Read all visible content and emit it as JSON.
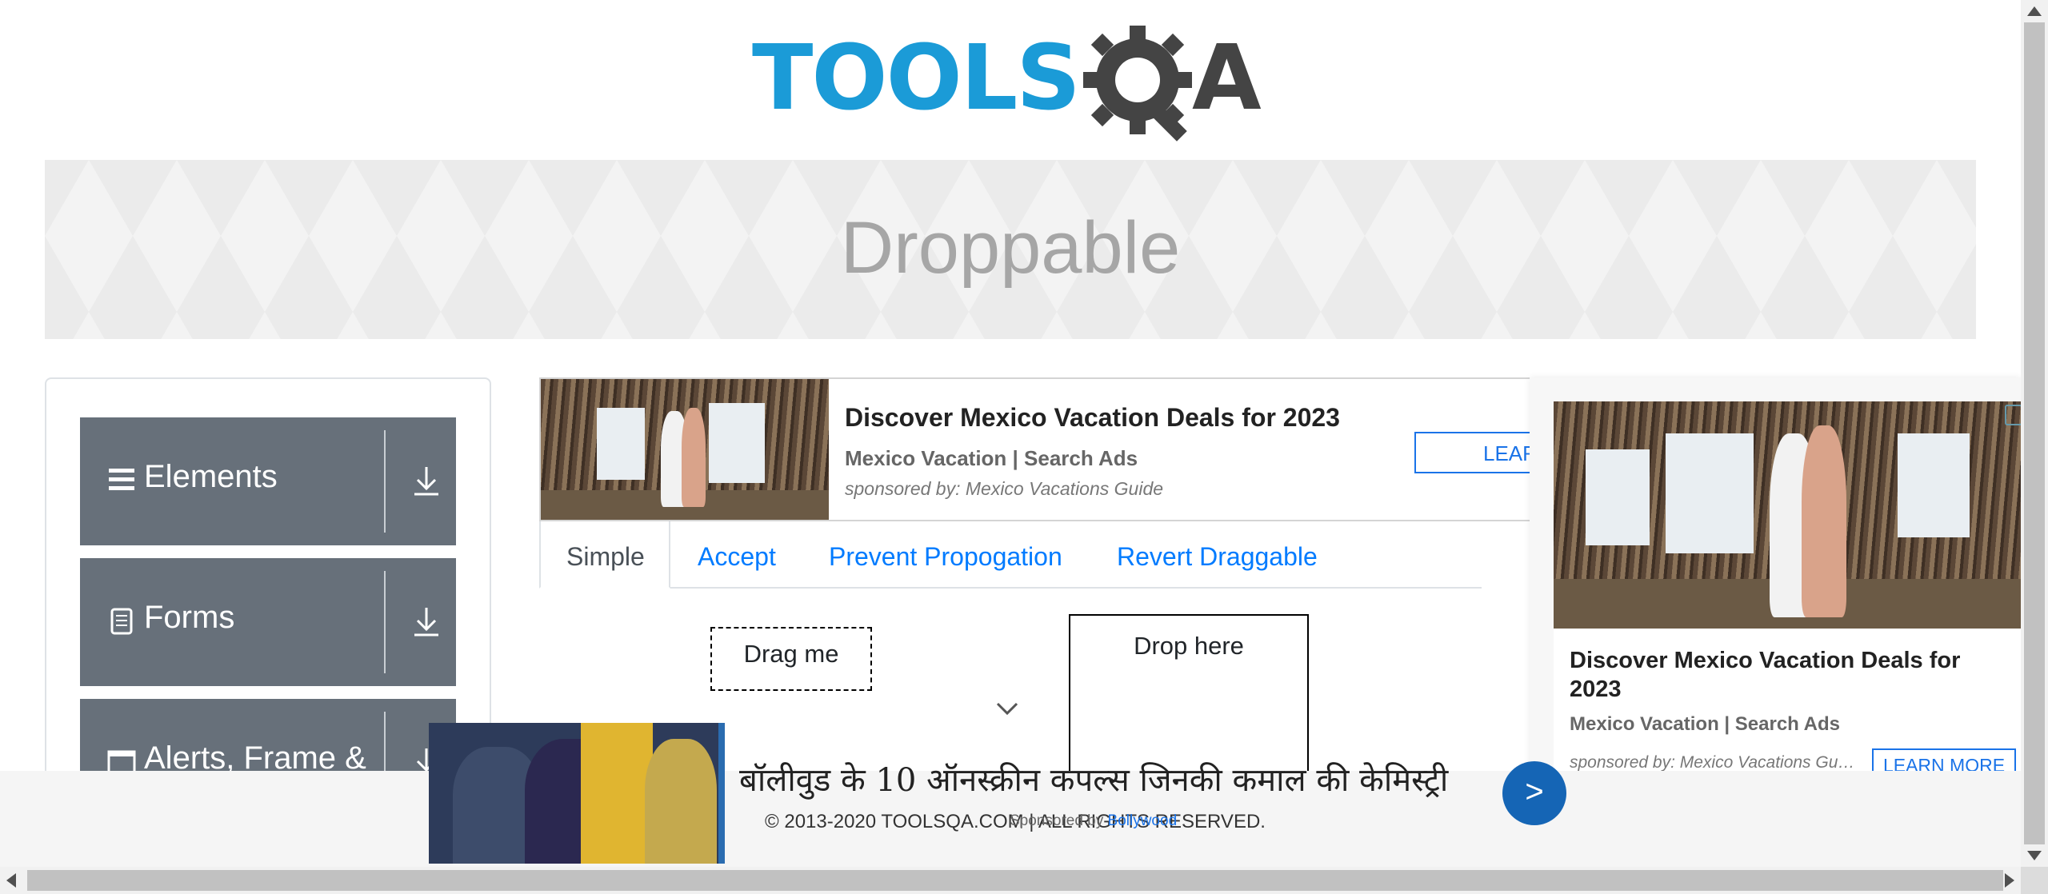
{
  "logo": {
    "tools": "TOOLS",
    "a": "A",
    "brand_color": "#1b9bd7",
    "dark_color": "#444444"
  },
  "banner": {
    "title": "Droppable"
  },
  "sidebar": {
    "groups": [
      {
        "label": "Elements",
        "icon": "hamburger-icon"
      },
      {
        "label": "Forms",
        "icon": "form-icon"
      },
      {
        "label": "Alerts, Frame & Windows",
        "icon": "window-icon"
      }
    ]
  },
  "ad_top": {
    "title": "Discover Mexico Vacation Deals for 2023",
    "subtitle": "Mexico Vacation | Search Ads",
    "sponsor": "sponsored by: Mexico Vacations Guide",
    "cta": "LEARN MORE"
  },
  "tabs": [
    {
      "label": "Simple",
      "active": true
    },
    {
      "label": "Accept",
      "active": false
    },
    {
      "label": "Prevent Propogation",
      "active": false
    },
    {
      "label": "Revert Draggable",
      "active": false
    }
  ],
  "draggable": {
    "label": "Drag me"
  },
  "droppable": {
    "label": "Drop here"
  },
  "ad_right": {
    "title": "Discover Mexico Vacation Deals for 2023",
    "subtitle": "Mexico Vacation | Search Ads",
    "sponsor": "sponsored by: Mexico Vacations Guide",
    "cta": "LEARN MORE"
  },
  "ad_bottom": {
    "headline": "बॉलीवुड के 10 ऑनस्क्रीन कपल्स जिनकी कमाल की केमिस्ट्री",
    "go_label": ">",
    "sponsored_prefix": "Sponsored by",
    "sponsored_by": "Bollywood"
  },
  "footer": {
    "text": "© 2013-2020 TOOLSQA.COM | ALL RIGHTS RESERVED."
  },
  "colors": {
    "link": "#007bff",
    "sidebar_group": "#67707a",
    "ad_button": "#1565b5"
  }
}
